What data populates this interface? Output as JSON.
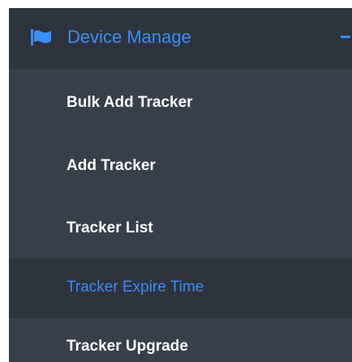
{
  "colors": {
    "sidebar_bg": "#373f4a",
    "header_bg": "#2d333d",
    "active_bg": "#2d333d",
    "accent": "#3b8ff7",
    "item_text": "#ffffff"
  },
  "sidebar": {
    "section": {
      "label": "Device Manage",
      "icon": "flag-icon",
      "toggle_icon": "minus-icon",
      "expanded": true
    },
    "items": [
      {
        "label": "Bulk Add Tracker",
        "active": false
      },
      {
        "label": "Add Tracker",
        "active": false
      },
      {
        "label": "Tracker List",
        "active": false
      },
      {
        "label": "Tracker Expire Time",
        "active": true
      },
      {
        "label": "Tracker Upgrade",
        "active": false
      }
    ]
  }
}
